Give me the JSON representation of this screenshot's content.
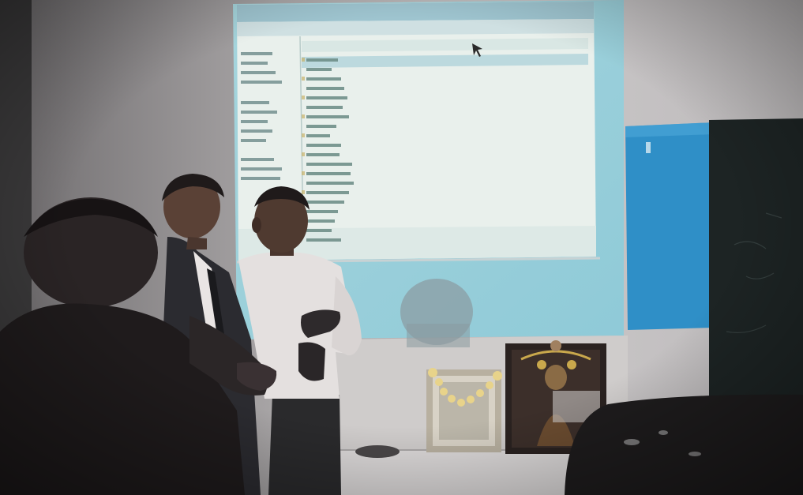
{
  "scene": {
    "description_items": [
      "projected-file-explorer",
      "presenter",
      "audience-member",
      "blackboard",
      "framed-portrait",
      "framed-picture",
      "garland"
    ]
  },
  "colors": {
    "wall": "#c9c6c6",
    "wall_shadow": "#8f8d8f",
    "projection_cyan": "#a9d8e2",
    "window_body": "#e7efe9",
    "blackboard": "#1d2424",
    "blue_panel": "#2f8fc7",
    "shirt": "#e4e0df",
    "suit": "#2b2b30",
    "skin": "#5a4136",
    "hair": "#1f1a1a"
  },
  "projection": {
    "file_list_count": 20,
    "nav_list_count": 12
  }
}
